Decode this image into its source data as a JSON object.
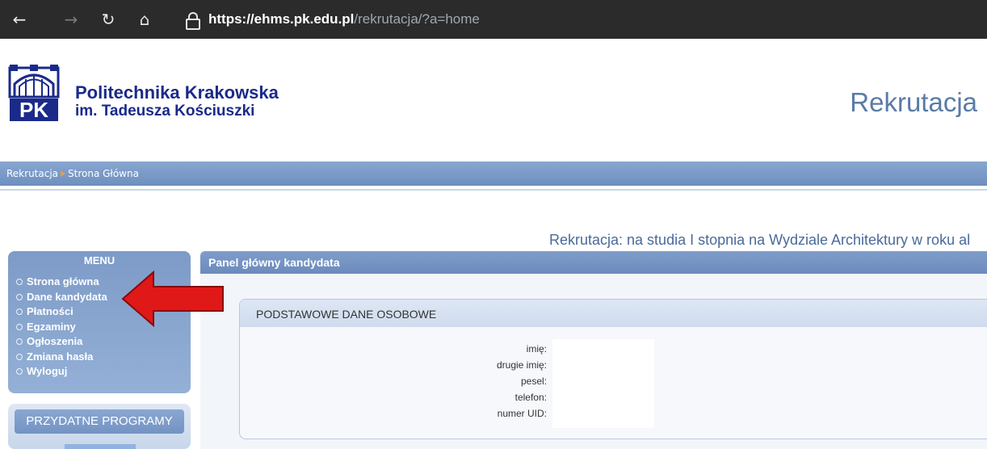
{
  "browser": {
    "url_host": "https://ehms.pk.edu.pl",
    "url_path": "/rekrutacja/?a=home",
    "icons": [
      "back-arrow-icon",
      "forward-arrow-icon",
      "refresh-icon",
      "home-icon",
      "lock-icon"
    ]
  },
  "header": {
    "logo_text": "PK",
    "university_line1": "Politechnika Krakowska",
    "university_line2": "im. Tadeusza Kościuszki",
    "section_title": "Rekrutacja"
  },
  "breadcrumb": {
    "items": [
      "Rekrutacja",
      "Strona Główna"
    ]
  },
  "notice": "Rekrutacja: na studia I stopnia na Wydziale Architektury w roku al",
  "menu": {
    "title": "MENU",
    "items": [
      {
        "label": "Strona główna"
      },
      {
        "label": "Dane kandydata"
      },
      {
        "label": "Płatności"
      },
      {
        "label": "Egzaminy"
      },
      {
        "label": "Ogłoszenia"
      },
      {
        "label": "Zmiana hasła"
      },
      {
        "label": "Wyloguj"
      }
    ]
  },
  "tools": {
    "title": "PRZYDATNE PROGRAMY"
  },
  "panel": {
    "title": "Panel główny kandydata",
    "section_title": "PODSTAWOWE DANE OSOBOWE",
    "fields": [
      {
        "label": "imię:",
        "value": ""
      },
      {
        "label": "drugie imię:",
        "value": ""
      },
      {
        "label": "pesel:",
        "value": ""
      },
      {
        "label": "telefon:",
        "value": ""
      },
      {
        "label": "numer UID:",
        "value": ""
      }
    ]
  },
  "colors": {
    "accent": "#6e8fc0",
    "brand_text": "#1a2a8a",
    "arrow": "#e01818"
  }
}
